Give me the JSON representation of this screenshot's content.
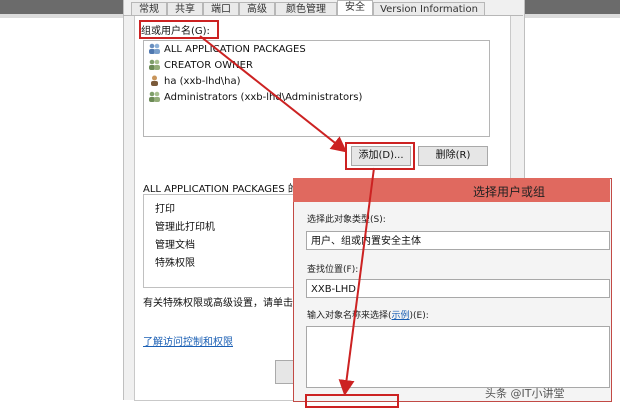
{
  "tabs": [
    "常规",
    "共享",
    "端口",
    "高级",
    "颜色管理",
    "安全",
    "Version Information"
  ],
  "group_label": "组或用户名(G):",
  "users": [
    {
      "icon": "group-icon",
      "label": "ALL APPLICATION PACKAGES"
    },
    {
      "icon": "group-icon",
      "label": "CREATOR OWNER"
    },
    {
      "icon": "user-icon",
      "label": "ha (xxb-lhd\\ha)"
    },
    {
      "icon": "group-icon",
      "label": "Administrators (xxb-lhd\\Administrators)"
    }
  ],
  "buttons": {
    "add": "添加(D)...",
    "remove": "删除(R)"
  },
  "permissions_label": "ALL APPLICATION PACKAGES 的",
  "permissions": [
    "打印",
    "管理此打印机",
    "管理文档",
    "特殊权限"
  ],
  "note": "有关特殊权限或高级设置，请单击",
  "link": "了解访问控制和权限",
  "select_dialog": {
    "title": "选择用户或组",
    "type_label": "选择此对象类型(S):",
    "type_value": "用户、组或内置安全主体",
    "location_label": "查找位置(F):",
    "location_value": "XXB-LHD",
    "names_label_before": "输入对象名称来选择(",
    "names_label_link": "示例",
    "names_label_after": ")(E):"
  },
  "watermark": "头条 @IT小讲堂",
  "colors": {
    "highlight": "#cc2222",
    "dialog_title": "#e0695f",
    "link": "#1a5fb4"
  }
}
